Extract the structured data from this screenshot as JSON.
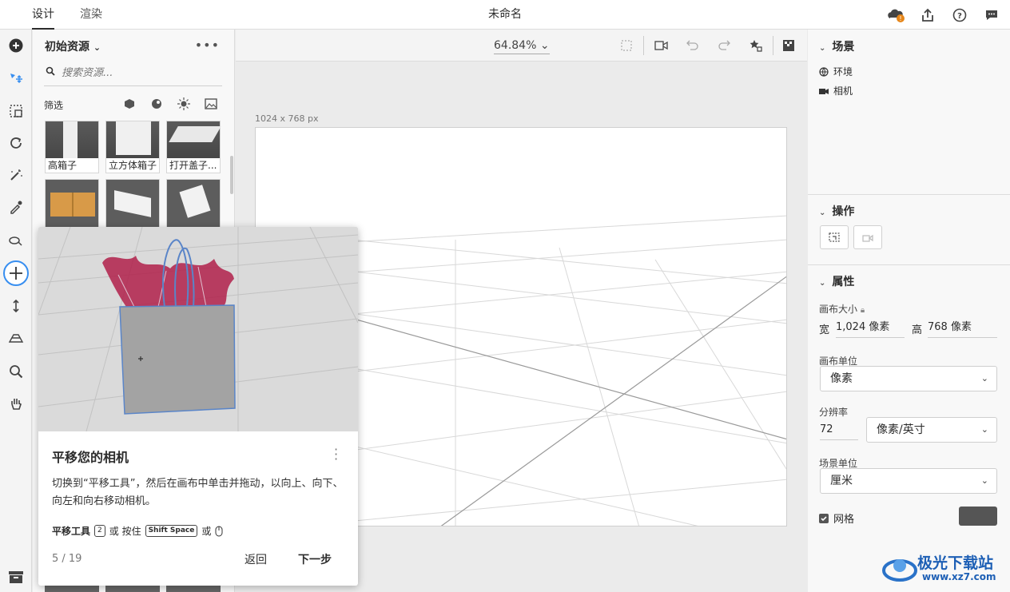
{
  "topbar": {
    "tabs": [
      {
        "label": "设计"
      },
      {
        "label": "渲染"
      }
    ],
    "title": "未命名"
  },
  "assets": {
    "title": "初始资源",
    "search_placeholder": "搜索资源...",
    "filter_label": "筛选",
    "items": [
      {
        "label": "高箱子"
      },
      {
        "label": "立方体箱子"
      },
      {
        "label": "打开盖子..."
      }
    ]
  },
  "canvas": {
    "zoom": "64.84%",
    "size_label": "1024 x 768 px"
  },
  "right": {
    "scene": {
      "title": "场景",
      "items": [
        {
          "label": "环境"
        },
        {
          "label": "相机"
        }
      ]
    },
    "actions": {
      "title": "操作"
    },
    "properties": {
      "title": "属性",
      "canvas_size_label": "画布大小",
      "width_label": "宽",
      "width_value": "1,024 像素",
      "height_label": "高",
      "height_value": "768 像素",
      "canvas_unit_label": "画布单位",
      "canvas_unit_value": "像素",
      "resolution_label": "分辨率",
      "resolution_value": "72",
      "resolution_unit": "像素/英寸",
      "scene_unit_label": "场景单位",
      "scene_unit_value": "厘米",
      "grid_label": "网格"
    }
  },
  "tutorial": {
    "title": "平移您的相机",
    "body": "切换到“平移工具”，然后在画布中单击并拖动，以向上、向下、向左和向右移动相机。",
    "shortcut_label": "平移工具",
    "key1": "2",
    "or1": "或 按住",
    "key2": "Shift Space",
    "or2": "或",
    "step": "5 / 19",
    "back": "返回",
    "next": "下一步"
  },
  "watermark": {
    "text": "极光下载站",
    "url": "www.xz7.com"
  },
  "colors": {
    "accent": "#378ef0",
    "grid_swatch": "#555555",
    "bag": "#a3a3a3",
    "tissue": "#b0204a"
  }
}
